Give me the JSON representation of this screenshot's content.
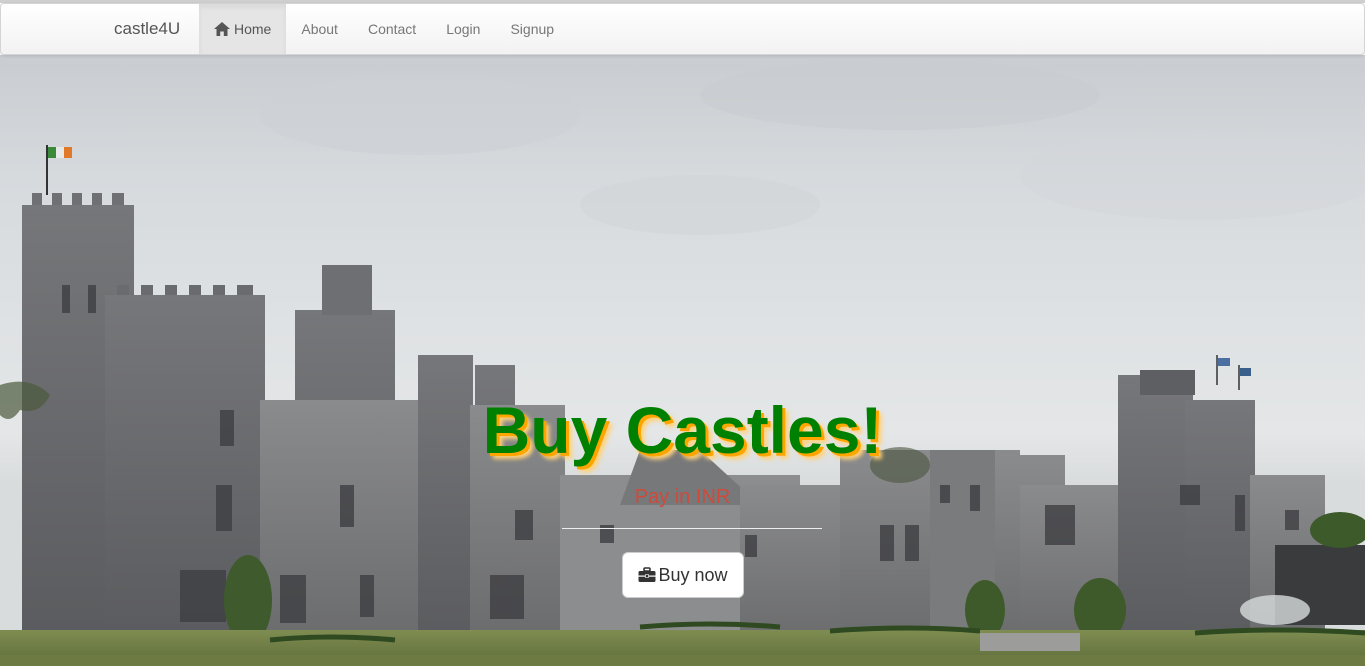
{
  "navbar": {
    "brand": "castle4U",
    "items": [
      {
        "label": "Home",
        "icon": "home-icon",
        "active": true
      },
      {
        "label": "About"
      },
      {
        "label": "Contact"
      },
      {
        "label": "Login"
      },
      {
        "label": "Signup"
      }
    ]
  },
  "hero": {
    "title": "Buy Castles!",
    "subtitle": "Pay in INR",
    "button_label": "Buy now",
    "button_icon": "briefcase-icon",
    "colors": {
      "title": "#008000",
      "title_shadow": "#ffa500",
      "subtitle": "#d04a3a"
    }
  }
}
